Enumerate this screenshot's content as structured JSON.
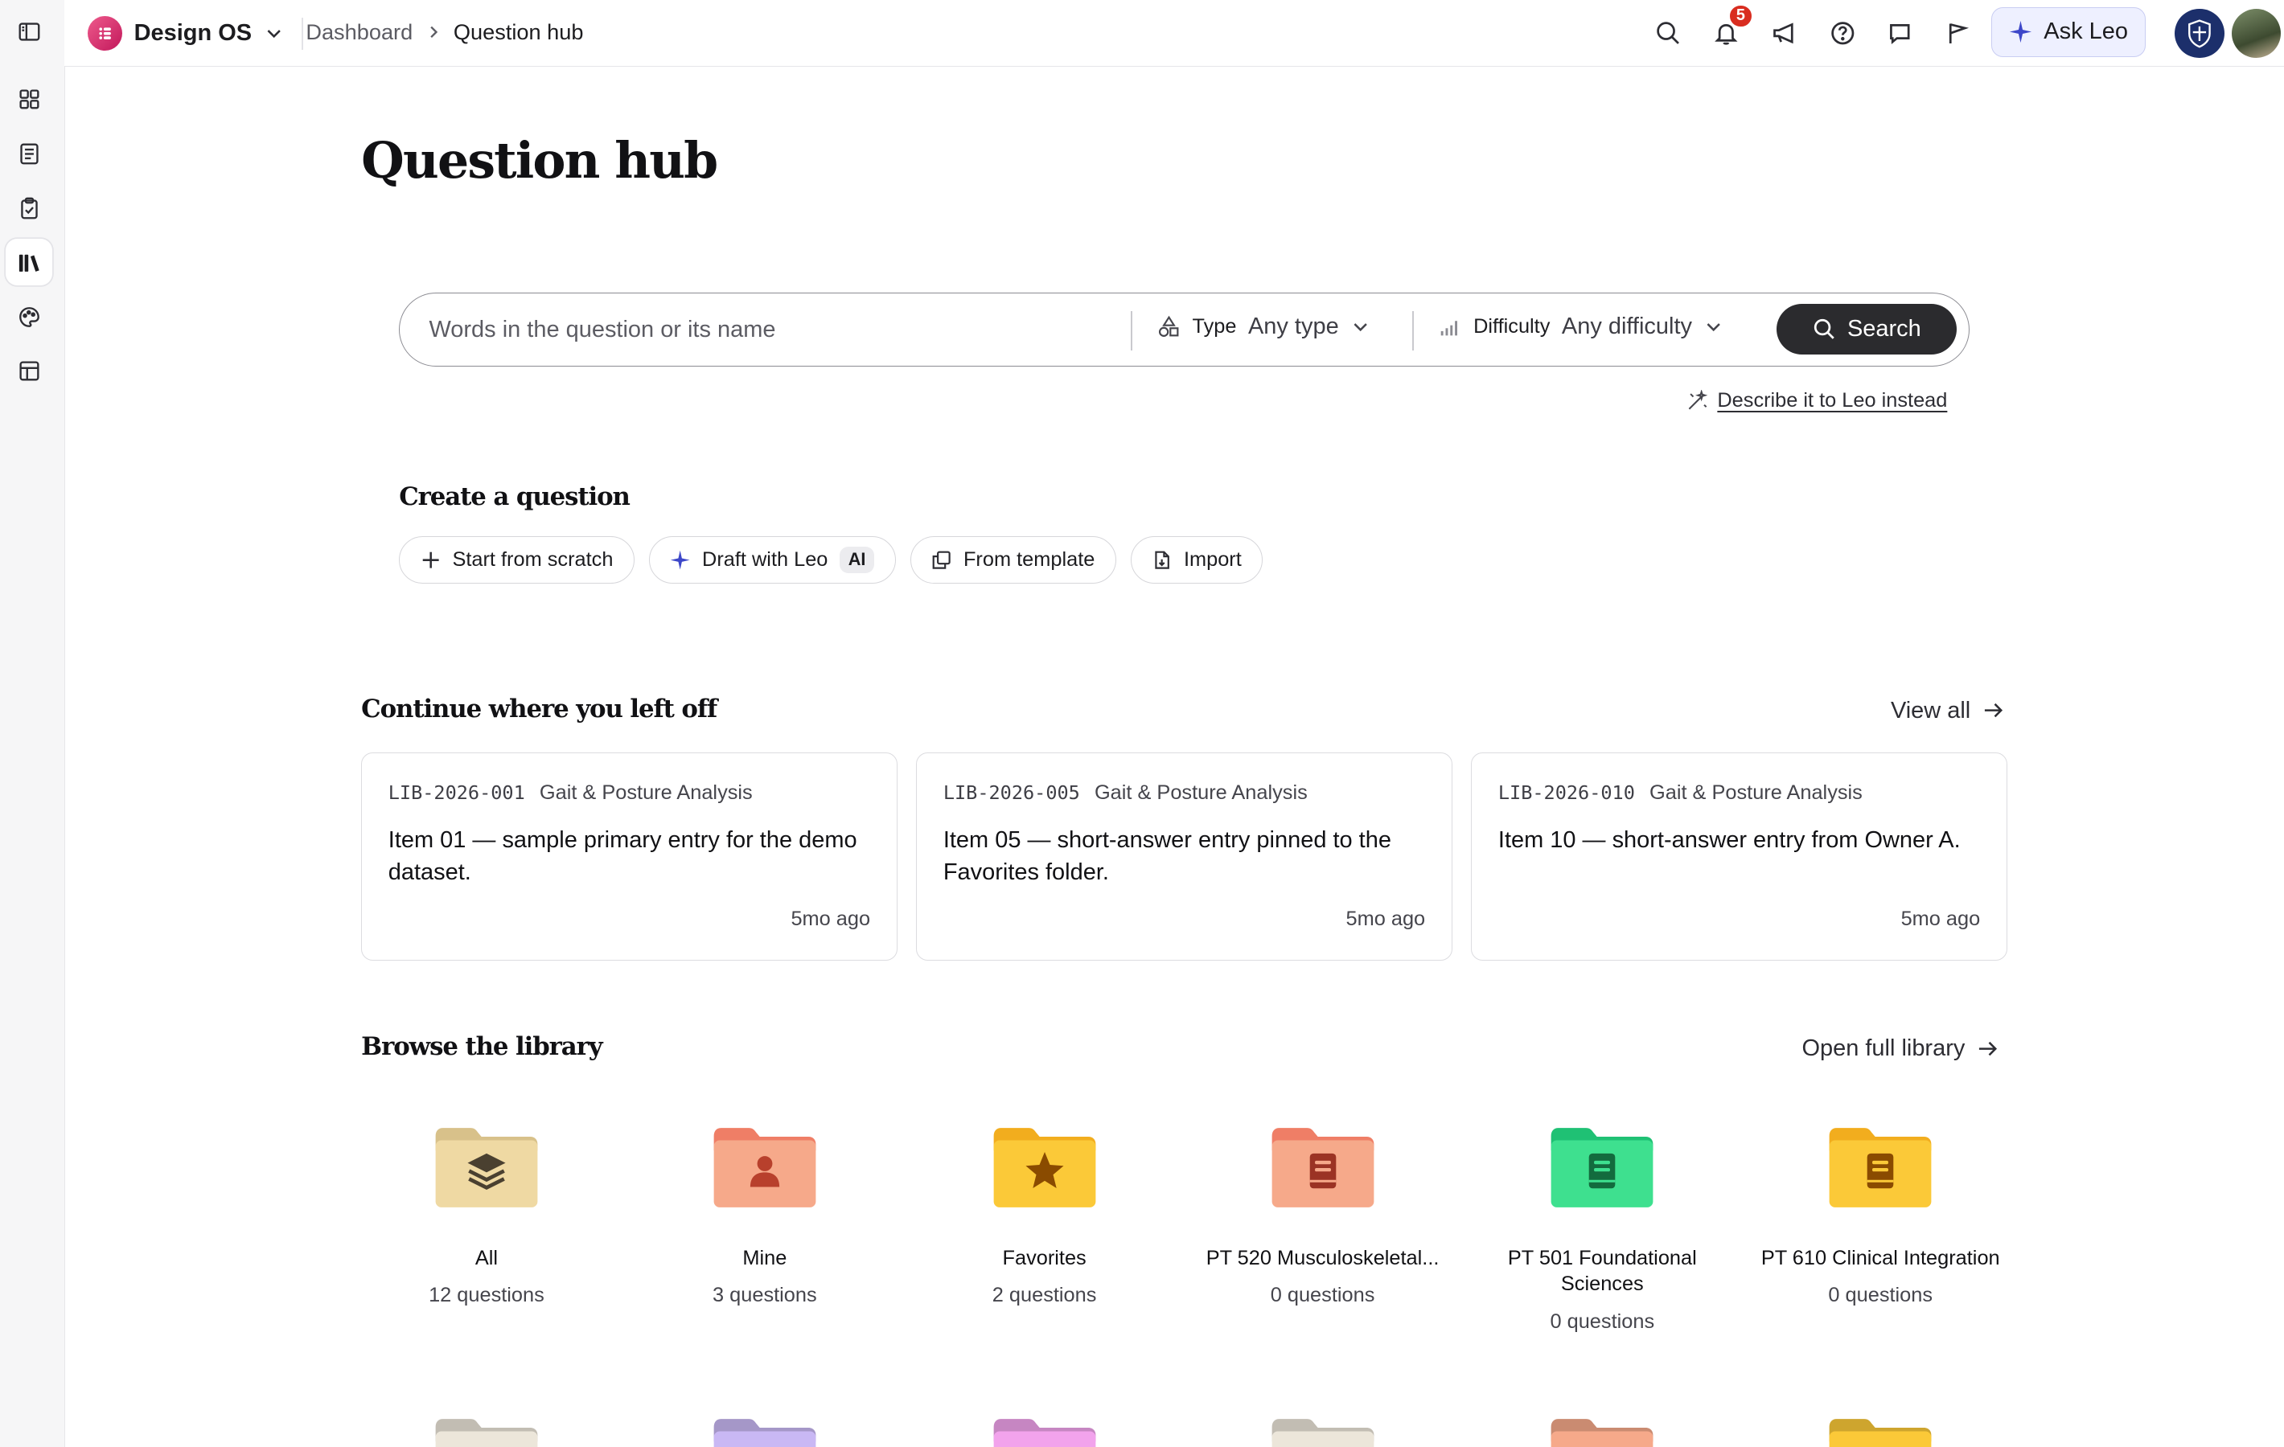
{
  "app": {
    "name": "Design OS",
    "breadcrumbs": [
      "Dashboard",
      "Question hub"
    ],
    "notifications_count": "5",
    "ask_leo_label": "Ask Leo"
  },
  "sidebar": {
    "items": [
      {
        "icon": "grid-icon"
      },
      {
        "icon": "document-icon"
      },
      {
        "icon": "clipboard-check-icon"
      },
      {
        "icon": "library-icon",
        "active": true
      },
      {
        "icon": "palette-icon"
      },
      {
        "icon": "layout-icon"
      }
    ]
  },
  "page": {
    "title": "Question hub"
  },
  "search": {
    "placeholder": "Words in the question or its name",
    "type_label": "Type",
    "type_value": "Any type",
    "difficulty_label": "Difficulty",
    "difficulty_value": "Any difficulty",
    "button_label": "Search",
    "describe_link": "Describe it to Leo instead"
  },
  "create": {
    "heading": "Create a question",
    "actions": [
      {
        "label": "Start from scratch",
        "icon": "plus-icon"
      },
      {
        "label": "Draft with Leo",
        "icon": "sparkle-icon",
        "tag": "AI"
      },
      {
        "label": "From template",
        "icon": "copy-icon"
      },
      {
        "label": "Import",
        "icon": "file-import-icon"
      }
    ]
  },
  "continue": {
    "heading": "Continue where you left off",
    "view_all": "View all",
    "cards": [
      {
        "code": "LIB-2026-001",
        "topic": "Gait & Posture Analysis",
        "title": "Item 01 — sample primary entry for the demo dataset.",
        "ago": "5mo ago"
      },
      {
        "code": "LIB-2026-005",
        "topic": "Gait & Posture Analysis",
        "title": "Item 05 — short-answer entry pinned to the Favorites folder.",
        "ago": "5mo ago"
      },
      {
        "code": "LIB-2026-010",
        "topic": "Gait & Posture Analysis",
        "title": "Item 10 — short-answer entry from Owner A.",
        "ago": "5mo ago"
      }
    ]
  },
  "library": {
    "heading": "Browse the library",
    "open_full": "Open full library",
    "folders": [
      {
        "name": "All",
        "count": "12 questions",
        "color": "#efd9a3",
        "tab": "#d8c18a",
        "glyph": "layers-icon"
      },
      {
        "name": "Mine",
        "count": "3 questions",
        "color": "#f6a98a",
        "tab": "#ef7e66",
        "glyph": "person-icon"
      },
      {
        "name": "Favorites",
        "count": "2 questions",
        "color": "#fbc938",
        "tab": "#f2ad1e",
        "glyph": "star-icon"
      },
      {
        "name": "PT 520 Musculoskeletal...",
        "count": "0 questions",
        "color": "#f6a98a",
        "tab": "#ef7e66",
        "glyph": "book-icon"
      },
      {
        "name": "PT 501 Foundational Sciences",
        "count": "0 questions",
        "color": "#3ee08f",
        "tab": "#1fc174",
        "glyph": "book-icon"
      },
      {
        "name": "PT 610 Clinical Integration",
        "count": "0 questions",
        "color": "#fbc938",
        "tab": "#f2ad1e",
        "glyph": "book-icon"
      }
    ],
    "more_folder_colors": [
      "#ece6da",
      "#c9b8f4",
      "#f2a3ec",
      "#ece6da",
      "#f6a98a",
      "#fbc938"
    ]
  }
}
